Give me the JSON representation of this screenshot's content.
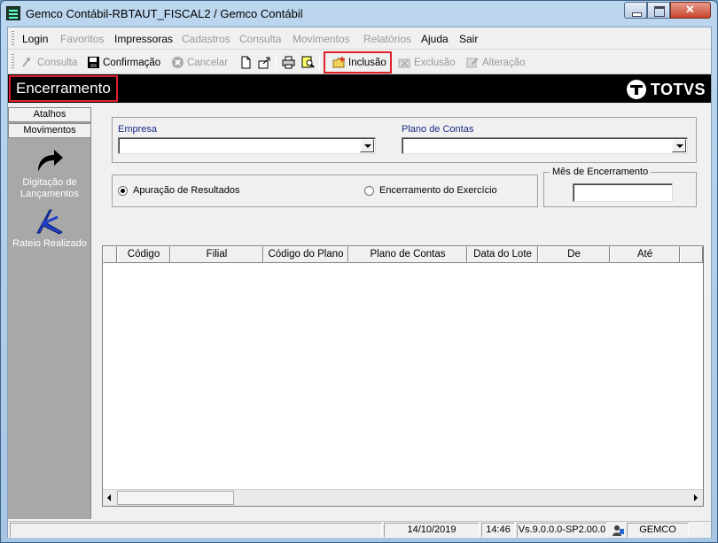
{
  "window": {
    "title": "Gemco Contábil-RBTAUT_FISCAL2 / Gemco Contábil"
  },
  "menu": [
    {
      "label": "Login",
      "enabled": true
    },
    {
      "label": "Favoritos",
      "enabled": false
    },
    {
      "label": "Impressoras",
      "enabled": true
    },
    {
      "label": "Cadastros",
      "enabled": false
    },
    {
      "label": "Consulta",
      "enabled": false
    },
    {
      "label": "Movimentos",
      "enabled": false
    },
    {
      "label": "Relatórios",
      "enabled": false
    },
    {
      "label": "Ajuda",
      "enabled": true
    },
    {
      "label": "Sair",
      "enabled": true
    }
  ],
  "toolbar": {
    "consulta": "Consulta",
    "confirmacao": "Confirmação",
    "cancelar": "Cancelar",
    "inclusao": "Inclusão",
    "exclusao": "Exclusão",
    "alteracao": "Alteração"
  },
  "header": {
    "title": "Encerramento",
    "brand": "TOTVS"
  },
  "sidebar": {
    "tabs": [
      "Atalhos",
      "Movimentos"
    ],
    "items": [
      {
        "label": "Digitação de Lançamentos",
        "icon": "curved-arrow-icon"
      },
      {
        "label": "Rateio Realizado",
        "icon": "rateio-icon"
      }
    ]
  },
  "form": {
    "empresa_label": "Empresa",
    "empresa_value": "",
    "plano_label": "Plano de Contas",
    "plano_value": "",
    "radio_apuracao": "Apuração de Resultados",
    "radio_encerramento": "Encerramento do Exercício",
    "selected_radio": "apuracao",
    "mes_label": "Mês de Encerramento",
    "mes_value": ""
  },
  "grid": {
    "columns": [
      "",
      "Código",
      "Filial",
      "Código do Plano",
      "Plano de Contas",
      "Data do Lote",
      "De",
      "Até",
      ""
    ],
    "rows": []
  },
  "status": {
    "date": "14/10/2019",
    "time": "14:46",
    "version": "Vs.9.0.0.0-SP2.00.0",
    "app": "GEMCO"
  },
  "colors": {
    "highlight": "#e0202a",
    "header_bg": "#000000",
    "label_blue": "#1a2a88"
  }
}
